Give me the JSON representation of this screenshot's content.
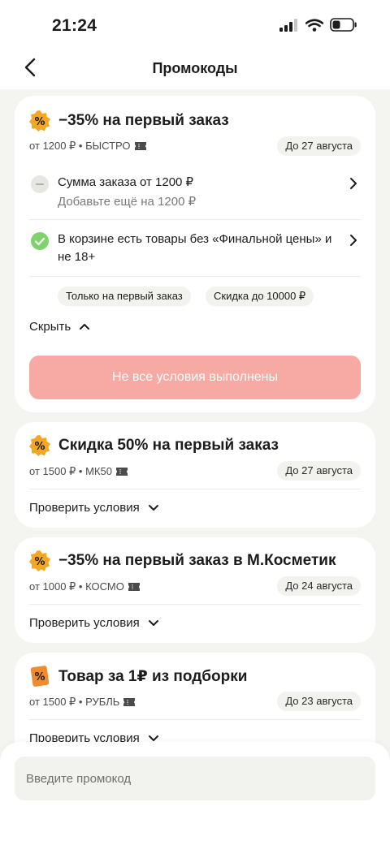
{
  "status_bar": {
    "time": "21:24"
  },
  "header": {
    "title": "Промокоды"
  },
  "colors": {
    "cta_disabled": "#f6aaa3",
    "badge_orange": "#f5a623",
    "check_green": "#7fd36b"
  },
  "promos": [
    {
      "title": "−35% на первый заказ",
      "meta": "от 1200 ₽ • БЫСТРО",
      "date": "До 27 августа",
      "icon": "percent-badge-icon",
      "conditions": [
        {
          "title": "Сумма заказа от 1200 ₽",
          "subtitle": "Добавьте ещё на 1200 ₽",
          "status": "unmet"
        },
        {
          "title": "В корзине есть товары без «Финальной цены» и не 18+",
          "status": "met"
        }
      ],
      "tags": [
        "Только на первый заказ",
        "Скидка до 10000 ₽"
      ],
      "toggle": "Скрыть",
      "cta": "Не все условия выполнены"
    },
    {
      "title": "Скидка 50% на первый заказ",
      "meta": "от 1500 ₽ • МК50",
      "date": "До 27 августа",
      "icon": "percent-badge-icon",
      "toggle": "Проверить условия"
    },
    {
      "title": "−35% на первый заказ в М.Косметик",
      "meta": "от 1000 ₽ • КОСМО",
      "date": "До 24 августа",
      "icon": "percent-badge-icon",
      "toggle": "Проверить условия"
    },
    {
      "title": "Товар за 1₽ из подборки",
      "meta": "от 1500 ₽ • РУБЛЬ",
      "date": "До 23 августа",
      "icon": "percent-ticket-icon",
      "toggle": "Проверить условия"
    }
  ],
  "promo_input": {
    "placeholder": "Введите промокод",
    "value": ""
  }
}
